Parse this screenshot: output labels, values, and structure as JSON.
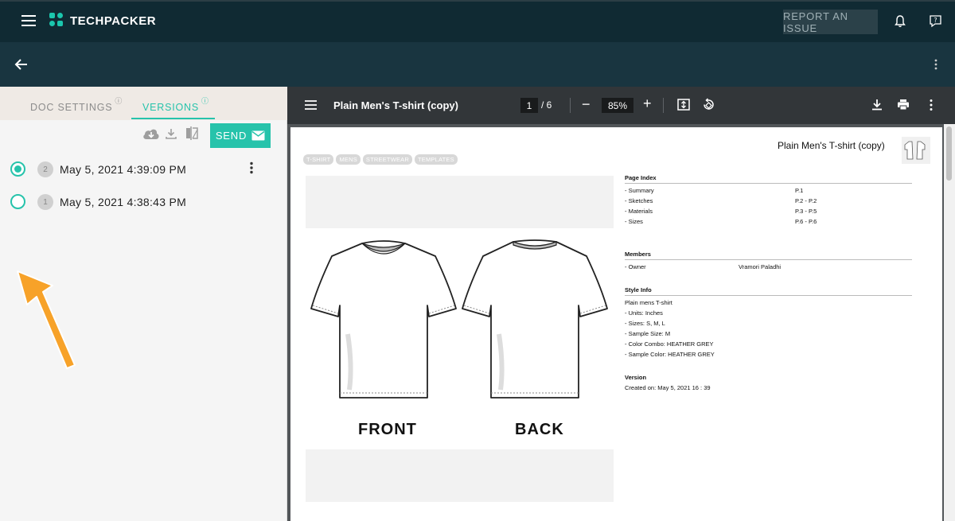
{
  "app": {
    "brand": "TECHPACKER",
    "report_label": "REPORT AN ISSUE",
    "accent": "#26c3ab"
  },
  "left_panel": {
    "tabs": [
      {
        "label": "DOC SETTINGS",
        "info": "i"
      },
      {
        "label": "VERSIONS",
        "info": "i"
      }
    ],
    "send_label": "SEND",
    "versions": [
      {
        "number": "2",
        "date": "May 5, 2021 4:39:09 PM",
        "selected": true
      },
      {
        "number": "1",
        "date": "May 5, 2021 4:38:43 PM",
        "selected": false
      }
    ]
  },
  "viewer": {
    "title": "Plain Men's T-shirt (copy)",
    "current_page": "1",
    "page_total": "/ 6",
    "zoom": "85%"
  },
  "document": {
    "title": "Plain Men's T-shirt (copy)",
    "tags": [
      "T-SHIRT",
      "MENS",
      "STREETWEAR",
      "TEMPLATES"
    ],
    "front_label": "FRONT",
    "back_label": "BACK",
    "page_index": {
      "heading": "Page Index",
      "rows": [
        {
          "name": "- Summary",
          "pages": "P.1"
        },
        {
          "name": "- Sketches",
          "pages": "P.2 - P.2"
        },
        {
          "name": "- Materials",
          "pages": "P.3 - P.5"
        },
        {
          "name": "- Sizes",
          "pages": "P.6 - P.6"
        }
      ]
    },
    "members": {
      "heading": "Members",
      "role": "- Owner",
      "name": "Vramori Paladhi"
    },
    "style_info": {
      "heading": "Style Info",
      "lines": [
        "Plain mens T-shirt",
        "- Units: Inches",
        "- Sizes: S, M, L",
        "- Sample Size: M",
        "- Color Combo: HEATHER GREY",
        "- Sample Color: HEATHER GREY"
      ]
    },
    "version": {
      "heading": "Version",
      "created": "Created on: May 5, 2021 16 : 39"
    }
  }
}
